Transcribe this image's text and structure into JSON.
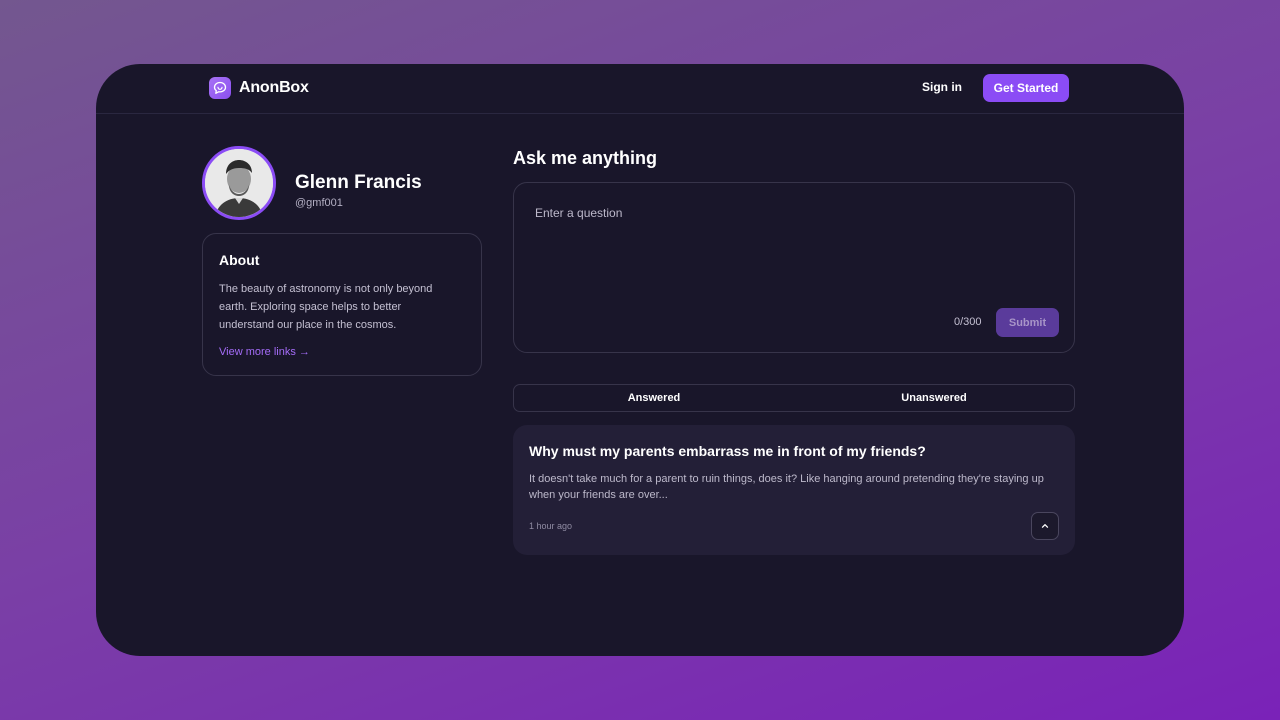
{
  "brand": {
    "name": "AnonBox",
    "accent": "#8b4cf5"
  },
  "nav": {
    "sign_in": "Sign in",
    "get_started": "Get Started"
  },
  "profile": {
    "name": "Glenn Francis",
    "handle": "@gmf001",
    "about_title": "About",
    "about_text": "The beauty of astronomy is not only beyond earth. Exploring space helps to better understand our place in the cosmos.",
    "view_more": "View more links →"
  },
  "ask": {
    "title": "Ask me anything",
    "placeholder": "Enter a question",
    "char_count": "0/300",
    "submit": "Submit"
  },
  "tabs": [
    {
      "label": "Answered"
    },
    {
      "label": "Unanswered"
    }
  ],
  "questions": [
    {
      "title": "Why must my parents embarrass me in front of my friends?",
      "excerpt": "It doesn't take much for a parent to ruin things, does it? Like hanging around pretending they're staying up when your friends are over...",
      "time": "1 hour ago",
      "toggle_icon": "chevron-up-icon"
    }
  ]
}
